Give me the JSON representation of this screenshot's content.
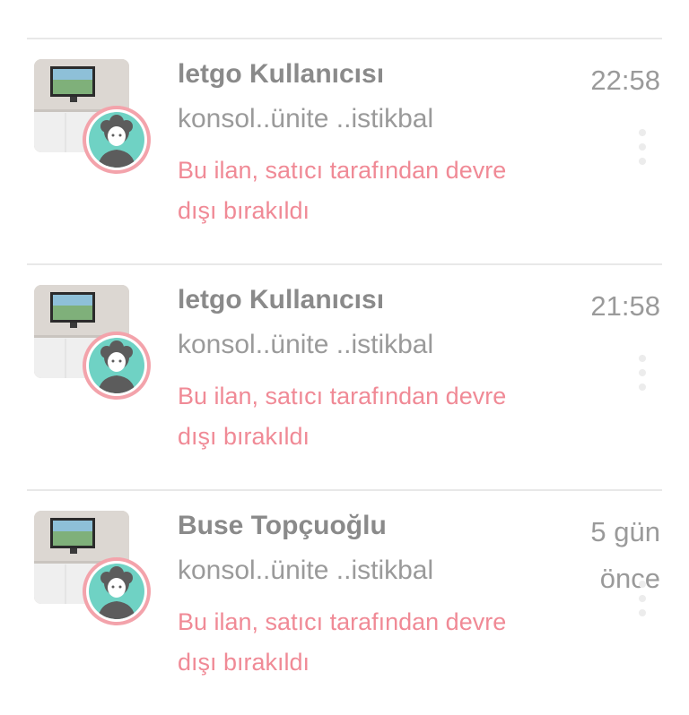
{
  "conversations": [
    {
      "name": "letgo Kullanıcısı",
      "subtitle": "konsol..ünite ..istikbal",
      "status": "Bu ilan, satıcı tarafından devre dışı bırakıldı",
      "time": "22:58",
      "avatar_icon": "user-avatar-icon",
      "thumbnail": "tv-console-photo",
      "more_icon": "more-vertical-icon"
    },
    {
      "name": "letgo Kullanıcısı",
      "subtitle": "konsol..ünite ..istikbal",
      "status": "Bu ilan, satıcı tarafından devre dışı bırakıldı",
      "time": "21:58",
      "avatar_icon": "user-avatar-icon",
      "thumbnail": "tv-console-photo",
      "more_icon": "more-vertical-icon"
    },
    {
      "name": "Buse Topçuoğlu",
      "subtitle": "konsol..ünite ..istikbal",
      "status": "Bu ilan, satıcı tarafından devre dışı bırakıldı",
      "time": "5 gün önce",
      "avatar_icon": "user-avatar-icon",
      "thumbnail": "tv-console-photo",
      "more_icon": "more-vertical-icon"
    }
  ],
  "colors": {
    "name": "#8a8a8a",
    "subtitle": "#9a9a9a",
    "status": "#f08a96",
    "avatar_ring": "#f3a3ab",
    "avatar_bg": "#6fd2c4",
    "divider": "#e8e8e8"
  }
}
